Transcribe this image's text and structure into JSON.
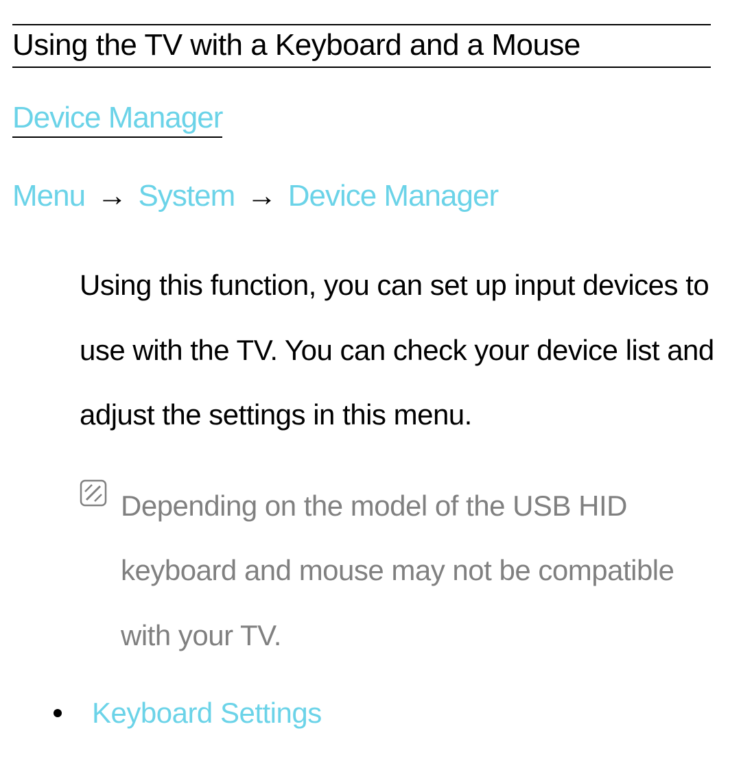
{
  "title": "Using the TV with a Keyboard and a Mouse",
  "section_heading": "Device Manager",
  "breadcrumb": {
    "item1": "Menu",
    "item2": "System",
    "item3": "Device Manager",
    "arrow": "→"
  },
  "description": "Using this function, you can set up input devices to use with the TV. You can check your device list and adjust the settings in this menu.",
  "note": "Depending on the model of the USB HID keyboard and mouse may not be compatible with your TV.",
  "list": {
    "item1": "Keyboard Settings"
  }
}
